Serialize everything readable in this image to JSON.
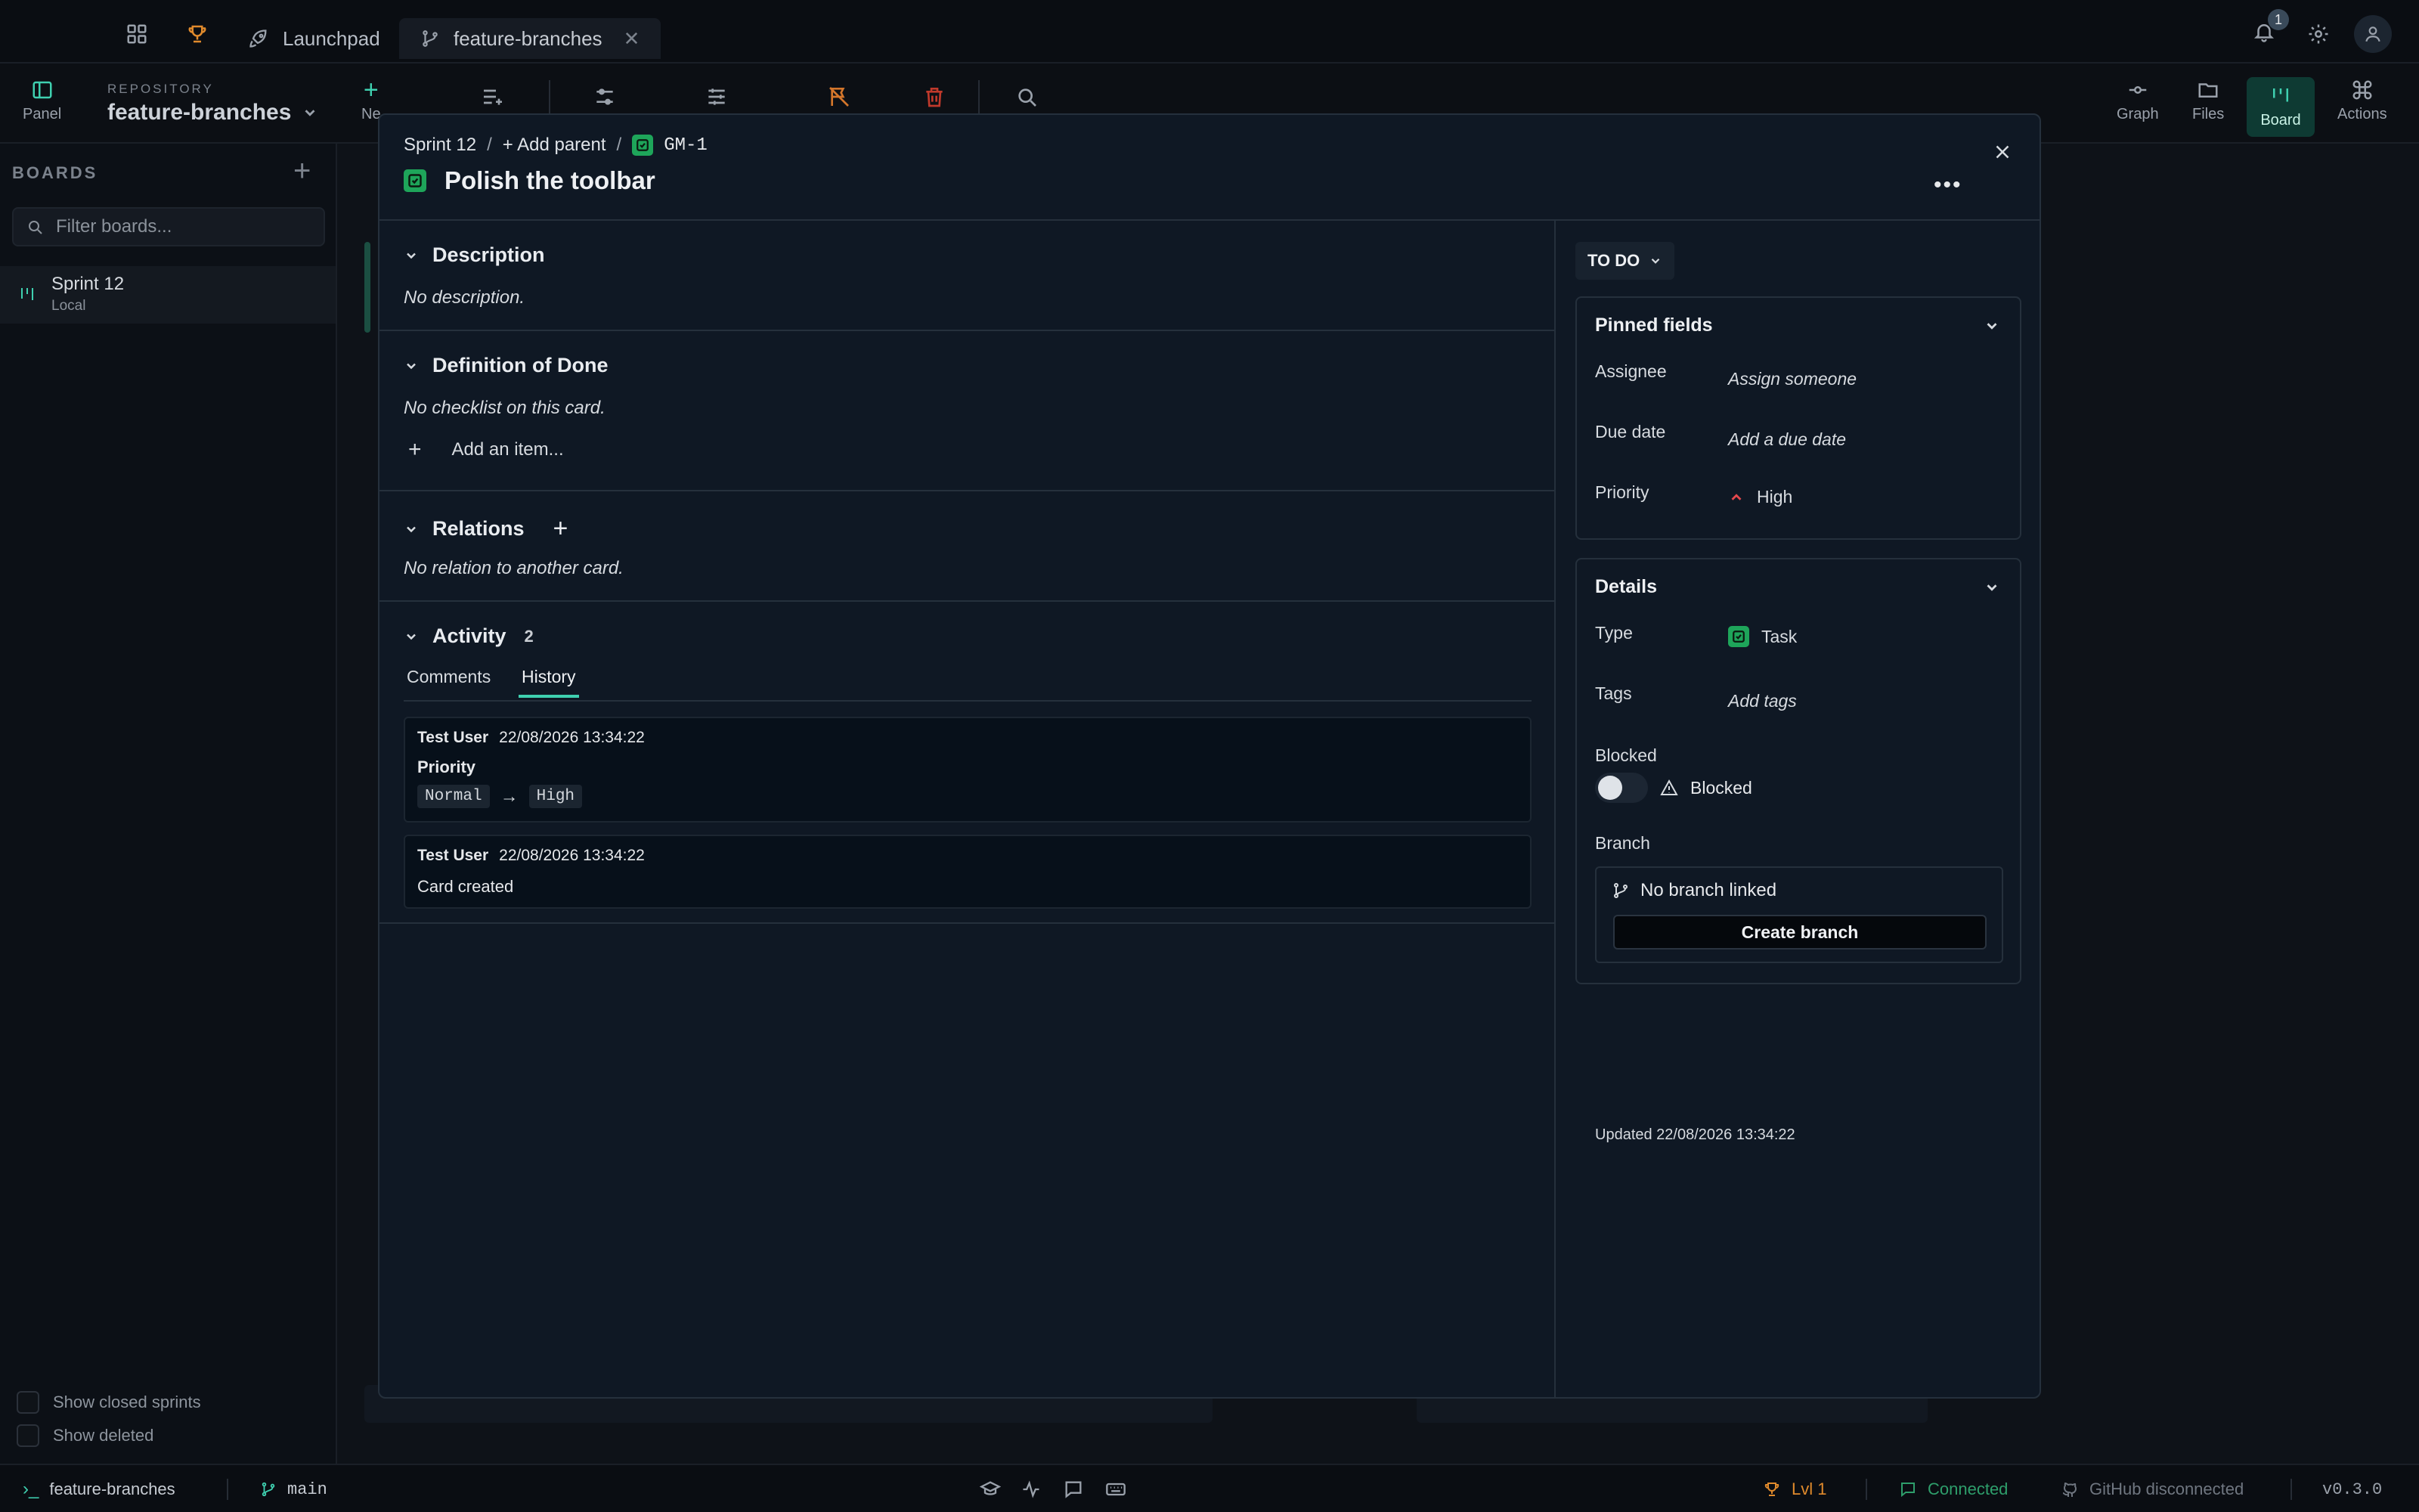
{
  "tabs": {
    "launchpad": "Launchpad",
    "feature_branches": "feature-branches"
  },
  "toolbar": {
    "panel_label": "Panel",
    "repo_label": "REPOSITORY",
    "repo_name": "feature-branches",
    "new_label": "Ne",
    "graph_label": "Graph",
    "files_label": "Files",
    "board_label": "Board",
    "actions_label": "Actions",
    "notification_count": "1"
  },
  "sidebar": {
    "heading": "BOARDS",
    "filter_placeholder": "Filter boards...",
    "sprint_name": "Sprint 12",
    "sprint_source": "Local",
    "show_closed": "Show closed sprints",
    "show_deleted": "Show deleted"
  },
  "modal": {
    "breadcrumb_sprint": "Sprint 12",
    "breadcrumb_sep": "/",
    "add_parent": "+ Add parent",
    "card_key": "GM-1",
    "title": "Polish the toolbar",
    "description": {
      "heading": "Description",
      "empty": "No description."
    },
    "dod": {
      "heading": "Definition of Done",
      "empty": "No checklist on this card.",
      "add_item": "Add an item..."
    },
    "relations": {
      "heading": "Relations",
      "empty": "No relation to another card."
    },
    "activity": {
      "heading": "Activity",
      "count": "2",
      "tab_comments": "Comments",
      "tab_history": "History",
      "entries": [
        {
          "user": "Test User",
          "time": "22/08/2026 13:34:22",
          "field": "Priority",
          "from": "Normal",
          "to": "High"
        },
        {
          "user": "Test User",
          "time": "22/08/2026 13:34:22",
          "text": "Card created"
        }
      ]
    },
    "status": "TO DO",
    "pinned": {
      "heading": "Pinned fields",
      "assignee_label": "Assignee",
      "assignee_value": "Assign someone",
      "due_label": "Due date",
      "due_value": "Add a due date",
      "priority_label": "Priority",
      "priority_value": "High"
    },
    "details": {
      "heading": "Details",
      "type_label": "Type",
      "type_value": "Task",
      "tags_label": "Tags",
      "tags_value": "Add tags",
      "blocked_label": "Blocked",
      "blocked_toggle_text": "Blocked",
      "branch_label": "Branch",
      "no_branch": "No branch linked",
      "create_branch": "Create branch"
    },
    "updated": "Updated 22/08/2026 13:34:22"
  },
  "statusbar": {
    "repo": "feature-branches",
    "branch": "main",
    "level": "Lvl 1",
    "connected": "Connected",
    "github": "GitHub disconnected",
    "version": "v0.3.0"
  },
  "colors": {
    "accent": "#3fd0b0",
    "task_green": "#1ea55a",
    "priority_red": "#e5484d",
    "delete_red": "#c0392b",
    "flag_orange": "#d4762b",
    "trophy_orange": "#e08a2c",
    "connected_green": "#2e9e6b"
  },
  "icons": {
    "priority": "chevron-up-icon",
    "card_type": "task-checkbox-icon",
    "branch": "git-branch-icon"
  }
}
